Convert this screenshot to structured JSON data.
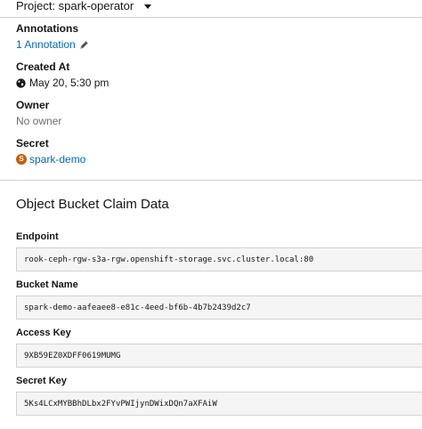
{
  "project": {
    "label": "Project: spark-operator"
  },
  "details": {
    "annotations": {
      "label": "Annotations",
      "value": "1 Annotation"
    },
    "created_at": {
      "label": "Created At",
      "value": "May 20, 5:30 pm"
    },
    "owner": {
      "label": "Owner",
      "value": "No owner"
    },
    "secret": {
      "label": "Secret",
      "badge": "S",
      "value": "spark-demo"
    }
  },
  "obc_data": {
    "title": "Object Bucket Claim Data",
    "endpoint": {
      "label": "Endpoint",
      "value": "rook-ceph-rgw-s3a-rgw.openshift-storage.svc.cluster.local:80"
    },
    "bucket_name": {
      "label": "Bucket Name",
      "value": "spark-demo-aafeaee8-e81c-4eed-bf6b-4b7b2439d2c7"
    },
    "access_key": {
      "label": "Access Key",
      "value": "9XB59EZ0XDFF0619MUMG"
    },
    "secret_key": {
      "label": "Secret Key",
      "value": "5Ks4LCxMYBBhDLbx2FYvPWIjynDWixDQn7aXFAiW"
    }
  },
  "colors": {
    "link": "#0066cc",
    "badge": "#c46100",
    "border": "#d2d2d2",
    "code_bg": "#f5f5f5"
  },
  "icons": [
    "chevron-down-icon",
    "pencil-icon",
    "globe-icon"
  ]
}
